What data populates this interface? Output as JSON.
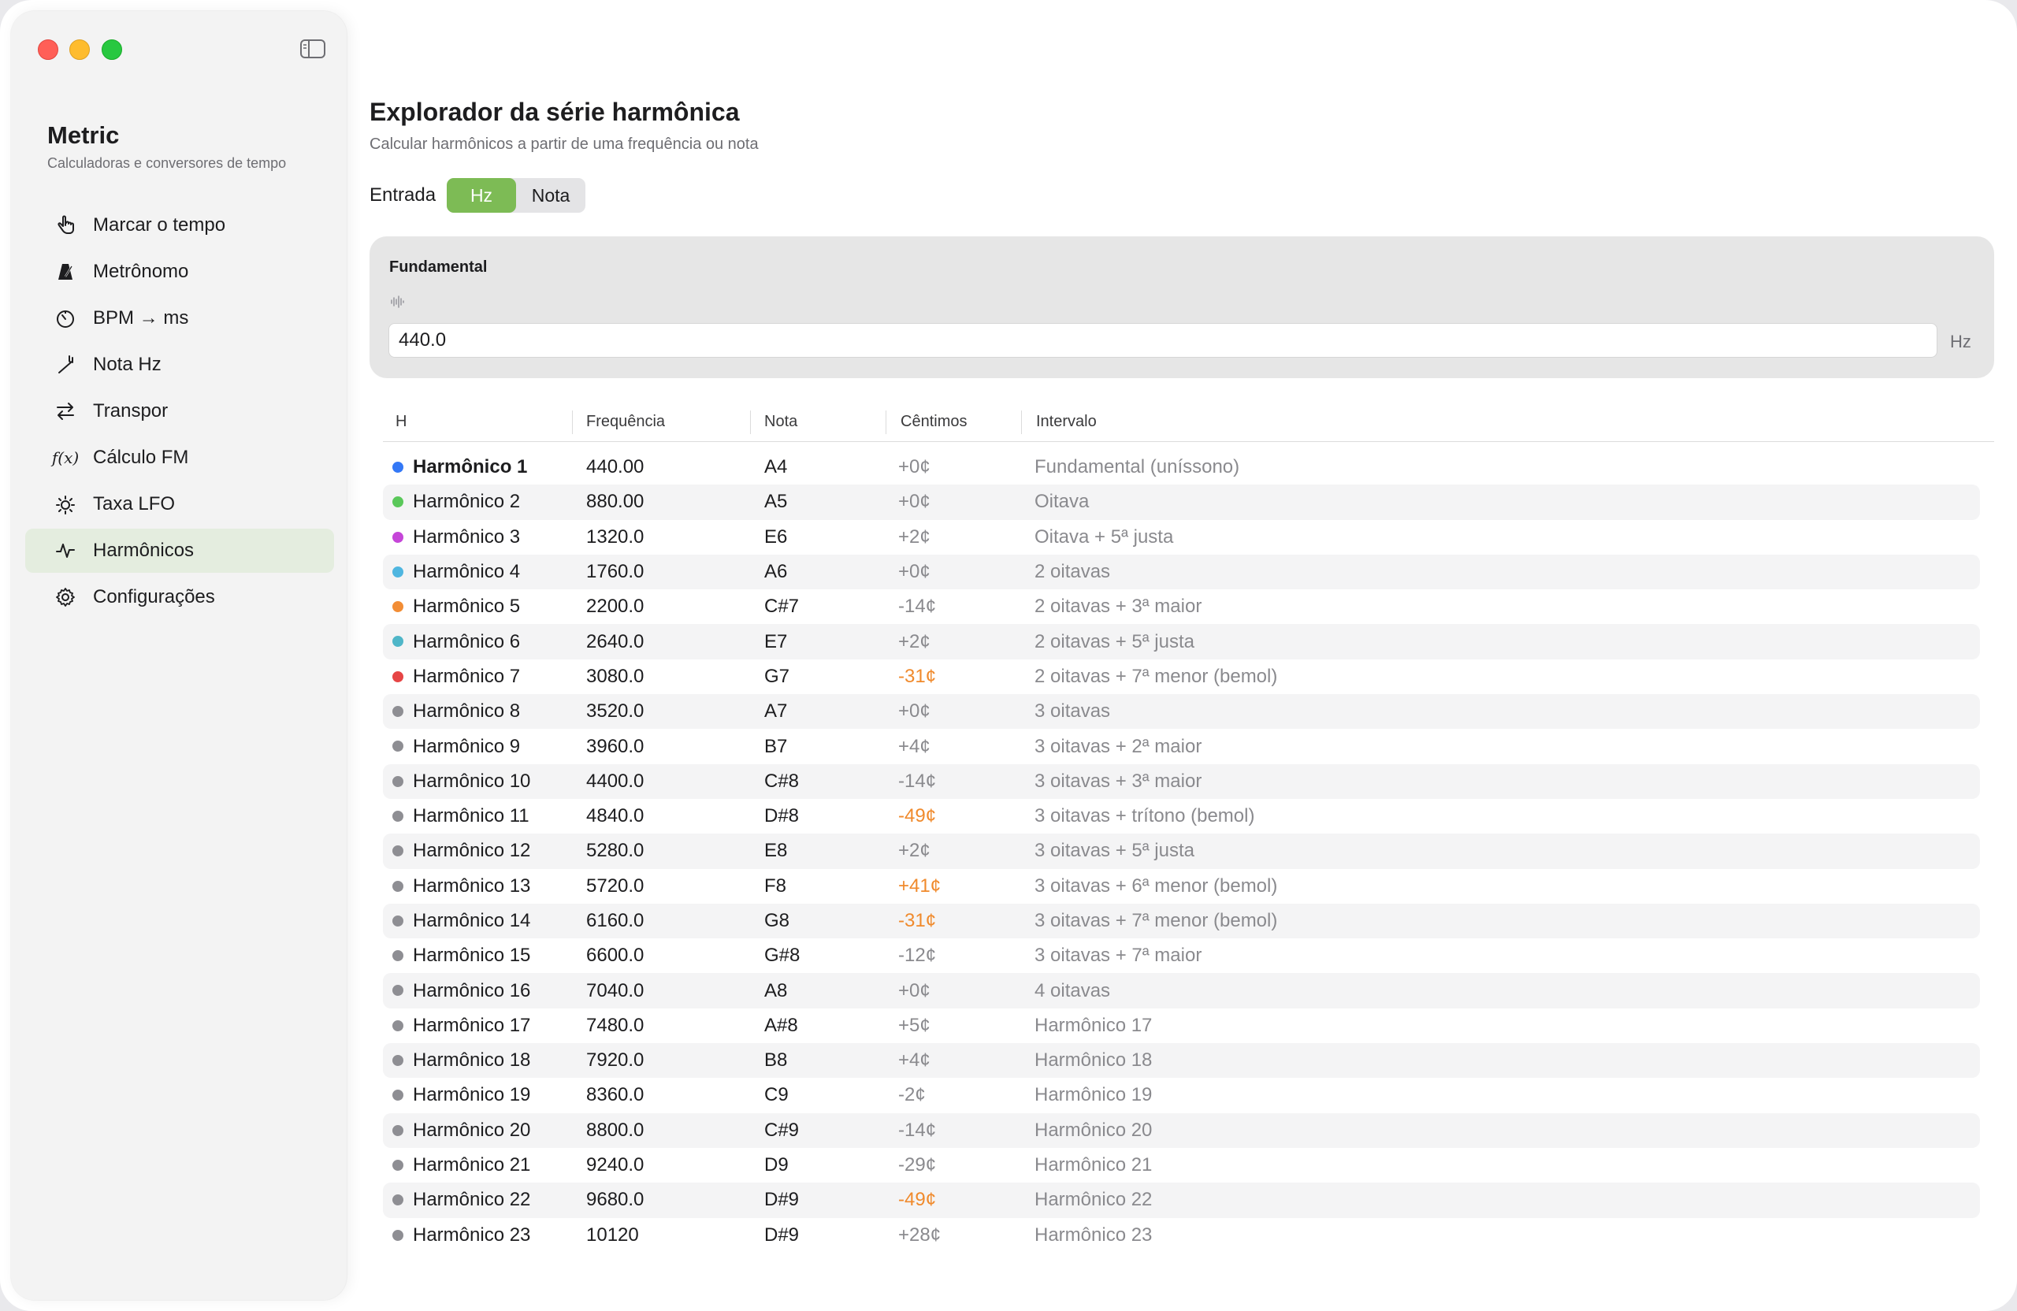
{
  "app": {
    "title": "Metric",
    "subtitle": "Calculadoras e conversores de tempo"
  },
  "sidebar": {
    "items": [
      {
        "label": "Marcar o tempo",
        "icon": "tap-hand-icon",
        "active": false
      },
      {
        "label": "Metrônomo",
        "icon": "metronome-icon",
        "active": false
      },
      {
        "label": "BPM → ms",
        "icon": "timer-icon",
        "active": false
      },
      {
        "label": "Nota Hz",
        "icon": "tuning-fork-icon",
        "active": false
      },
      {
        "label": "Transpor",
        "icon": "transpose-arrows-icon",
        "active": false
      },
      {
        "label": "Cálculo FM",
        "icon": "function-icon",
        "glyph": "f(x)",
        "active": false
      },
      {
        "label": "Taxa LFO",
        "icon": "lfo-sun-icon",
        "active": false
      },
      {
        "label": "Harmônicos",
        "icon": "waveform-icon",
        "active": true
      },
      {
        "label": "Configurações",
        "icon": "gear-icon",
        "active": false
      }
    ]
  },
  "page": {
    "title": "Explorador da série harmônica",
    "subtitle": "Calcular harmônicos a partir de uma frequência ou nota"
  },
  "input_mode": {
    "label": "Entrada",
    "options": [
      "Hz",
      "Nota"
    ],
    "selected": "Hz"
  },
  "fundamental": {
    "label": "Fundamental",
    "value": "440.0",
    "unit": "Hz"
  },
  "table": {
    "headers": [
      "H",
      "Frequência",
      "Nota",
      "Cêntimos",
      "Intervalo"
    ],
    "rows": [
      {
        "name": "Harmônico 1",
        "freq": "440.00",
        "note": "A4",
        "cents": "+0¢",
        "interval": "Fundamental (uníssono)",
        "dot": "#3478f6",
        "highlight": false
      },
      {
        "name": "Harmônico 2",
        "freq": "880.00",
        "note": "A5",
        "cents": "+0¢",
        "interval": "Oitava",
        "dot": "#5ac85a",
        "highlight": false
      },
      {
        "name": "Harmônico 3",
        "freq": "1320.0",
        "note": "E6",
        "cents": "+2¢",
        "interval": "Oitava + 5ª justa",
        "dot": "#c546d8",
        "highlight": false
      },
      {
        "name": "Harmônico 4",
        "freq": "1760.0",
        "note": "A6",
        "cents": "+0¢",
        "interval": "2 oitavas",
        "dot": "#4fb6e0",
        "highlight": false
      },
      {
        "name": "Harmônico 5",
        "freq": "2200.0",
        "note": "C#7",
        "cents": "-14¢",
        "interval": "2 oitavas + 3ª maior",
        "dot": "#f28d35",
        "highlight": false
      },
      {
        "name": "Harmônico 6",
        "freq": "2640.0",
        "note": "E7",
        "cents": "+2¢",
        "interval": "2 oitavas + 5ª justa",
        "dot": "#4fb6c8",
        "highlight": false
      },
      {
        "name": "Harmônico 7",
        "freq": "3080.0",
        "note": "G7",
        "cents": "-31¢",
        "interval": "2 oitavas + 7ª menor (bemol)",
        "dot": "#e64545",
        "highlight": true
      },
      {
        "name": "Harmônico 8",
        "freq": "3520.0",
        "note": "A7",
        "cents": "+0¢",
        "interval": "3 oitavas",
        "dot": "#8e8e93",
        "highlight": false
      },
      {
        "name": "Harmônico 9",
        "freq": "3960.0",
        "note": "B7",
        "cents": "+4¢",
        "interval": "3 oitavas + 2ª maior",
        "dot": "#8e8e93",
        "highlight": false
      },
      {
        "name": "Harmônico 10",
        "freq": "4400.0",
        "note": "C#8",
        "cents": "-14¢",
        "interval": "3 oitavas + 3ª maior",
        "dot": "#8e8e93",
        "highlight": false
      },
      {
        "name": "Harmônico 11",
        "freq": "4840.0",
        "note": "D#8",
        "cents": "-49¢",
        "interval": "3 oitavas + trítono (bemol)",
        "dot": "#8e8e93",
        "highlight": true
      },
      {
        "name": "Harmônico 12",
        "freq": "5280.0",
        "note": "E8",
        "cents": "+2¢",
        "interval": "3 oitavas + 5ª justa",
        "dot": "#8e8e93",
        "highlight": false
      },
      {
        "name": "Harmônico 13",
        "freq": "5720.0",
        "note": "F8",
        "cents": "+41¢",
        "interval": "3 oitavas + 6ª menor (bemol)",
        "dot": "#8e8e93",
        "highlight": true
      },
      {
        "name": "Harmônico 14",
        "freq": "6160.0",
        "note": "G8",
        "cents": "-31¢",
        "interval": "3 oitavas + 7ª menor (bemol)",
        "dot": "#8e8e93",
        "highlight": true
      },
      {
        "name": "Harmônico 15",
        "freq": "6600.0",
        "note": "G#8",
        "cents": "-12¢",
        "interval": "3 oitavas + 7ª maior",
        "dot": "#8e8e93",
        "highlight": false
      },
      {
        "name": "Harmônico 16",
        "freq": "7040.0",
        "note": "A8",
        "cents": "+0¢",
        "interval": "4 oitavas",
        "dot": "#8e8e93",
        "highlight": false
      },
      {
        "name": "Harmônico 17",
        "freq": "7480.0",
        "note": "A#8",
        "cents": "+5¢",
        "interval": "Harmônico 17",
        "dot": "#8e8e93",
        "highlight": false
      },
      {
        "name": "Harmônico 18",
        "freq": "7920.0",
        "note": "B8",
        "cents": "+4¢",
        "interval": "Harmônico 18",
        "dot": "#8e8e93",
        "highlight": false
      },
      {
        "name": "Harmônico 19",
        "freq": "8360.0",
        "note": "C9",
        "cents": "-2¢",
        "interval": "Harmônico 19",
        "dot": "#8e8e93",
        "highlight": false
      },
      {
        "name": "Harmônico 20",
        "freq": "8800.0",
        "note": "C#9",
        "cents": "-14¢",
        "interval": "Harmônico 20",
        "dot": "#8e8e93",
        "highlight": false
      },
      {
        "name": "Harmônico 21",
        "freq": "9240.0",
        "note": "D9",
        "cents": "-29¢",
        "interval": "Harmônico 21",
        "dot": "#8e8e93",
        "highlight": false
      },
      {
        "name": "Harmônico 22",
        "freq": "9680.0",
        "note": "D#9",
        "cents": "-49¢",
        "interval": "Harmônico 22",
        "dot": "#8e8e93",
        "highlight": true
      },
      {
        "name": "Harmônico 23",
        "freq": "10120",
        "note": "D#9",
        "cents": "+28¢",
        "interval": "Harmônico 23",
        "dot": "#8e8e93",
        "highlight": false
      }
    ]
  },
  "colors": {
    "accent": "#7dbb55",
    "warning": "#f08a2c",
    "sidebar_active": "#e4eddf"
  }
}
